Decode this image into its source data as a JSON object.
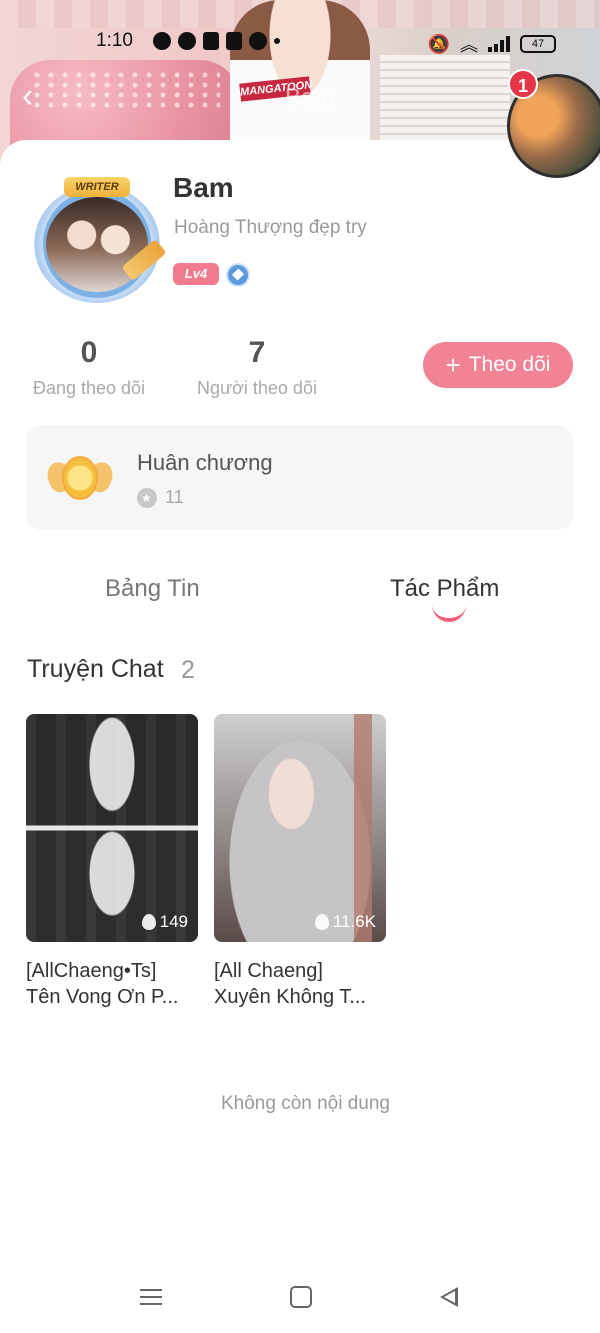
{
  "status_bar": {
    "time": "1:10",
    "battery": "47"
  },
  "header": {
    "overlay_title": "Bam",
    "shirt_label": "MANGATOON",
    "notification_count": "1"
  },
  "profile": {
    "badge": "WRITER",
    "name": "Bam",
    "bio": "Hoàng Thượng đẹp try",
    "level": "Lv4"
  },
  "stats": {
    "following": {
      "value": "0",
      "label": "Đang theo dõi"
    },
    "followers": {
      "value": "7",
      "label": "Người theo dõi"
    }
  },
  "follow_button": {
    "label": "Theo dõi"
  },
  "medals": {
    "title": "Huân chương",
    "count": "11"
  },
  "tabs": [
    {
      "label": "Bảng Tin",
      "active": false
    },
    {
      "label": "Tác Phẩm",
      "active": true
    }
  ],
  "section": {
    "title": "Truyện Chat",
    "count": "2"
  },
  "stories": [
    {
      "title_line1": "[AllChaeng•Ts]",
      "title_line2": "Tên Vong Ơn P...",
      "views": "149"
    },
    {
      "title_line1": "[All Chaeng]",
      "title_line2": "Xuyên Không T...",
      "views": "11.6K"
    }
  ],
  "end_message": "Không còn nội dung",
  "colors": {
    "accent": "#f28394",
    "tab_indicator": "#f0607a",
    "badge_red": "#e53548"
  }
}
